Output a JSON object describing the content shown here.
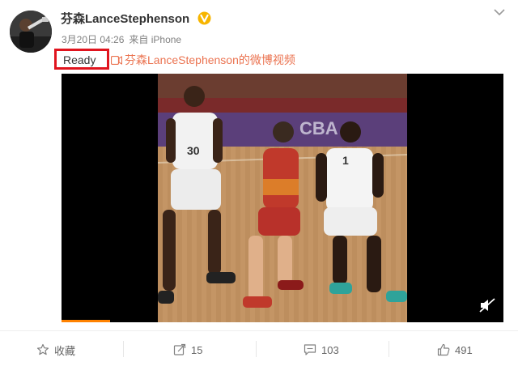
{
  "user": {
    "name": "芬森LanceStephenson"
  },
  "meta": {
    "date": "3月20日 04:26",
    "source": "来自 iPhone"
  },
  "post": {
    "text": "Ready",
    "video_link": "芬森LanceStephenson的微博视频"
  },
  "video": {
    "progress_fraction": 0.11,
    "player_numbers": [
      "30",
      "1"
    ]
  },
  "actions": {
    "favorite": "收藏",
    "repost_count": "15",
    "comment_count": "103",
    "like_count": "491"
  },
  "colors": {
    "accent": "#eb7350",
    "highlight_box": "#e0141e",
    "verified": "#f7b500",
    "progress": "#ff8200"
  }
}
